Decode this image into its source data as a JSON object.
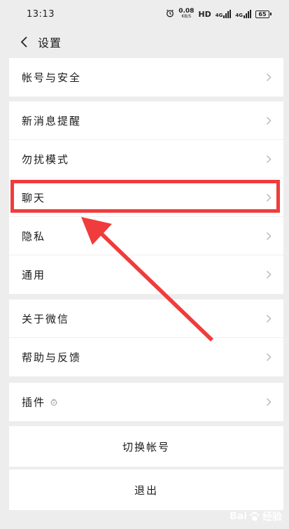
{
  "status": {
    "time": "13:13",
    "speed": "0.08",
    "speed_unit": "KB/S",
    "hd": "HD",
    "net1": "4G",
    "net2": "4G",
    "battery": "65"
  },
  "header": {
    "title": "设置"
  },
  "groups": [
    {
      "items": [
        {
          "label": "帐号与安全"
        }
      ]
    },
    {
      "items": [
        {
          "label": "新消息提醒"
        },
        {
          "label": "勿扰模式"
        },
        {
          "label": "聊天"
        },
        {
          "label": "隐私"
        },
        {
          "label": "通用"
        }
      ]
    },
    {
      "items": [
        {
          "label": "关于微信"
        },
        {
          "label": "帮助与反馈"
        }
      ]
    },
    {
      "items": [
        {
          "label": "插件"
        }
      ]
    }
  ],
  "actions": {
    "switch_account": "切换帐号",
    "logout": "退出"
  },
  "watermark": {
    "brand_left": "Bai",
    "brand_right": "经验"
  },
  "colors": {
    "highlight": "#f03c3c",
    "background": "#ededed"
  }
}
